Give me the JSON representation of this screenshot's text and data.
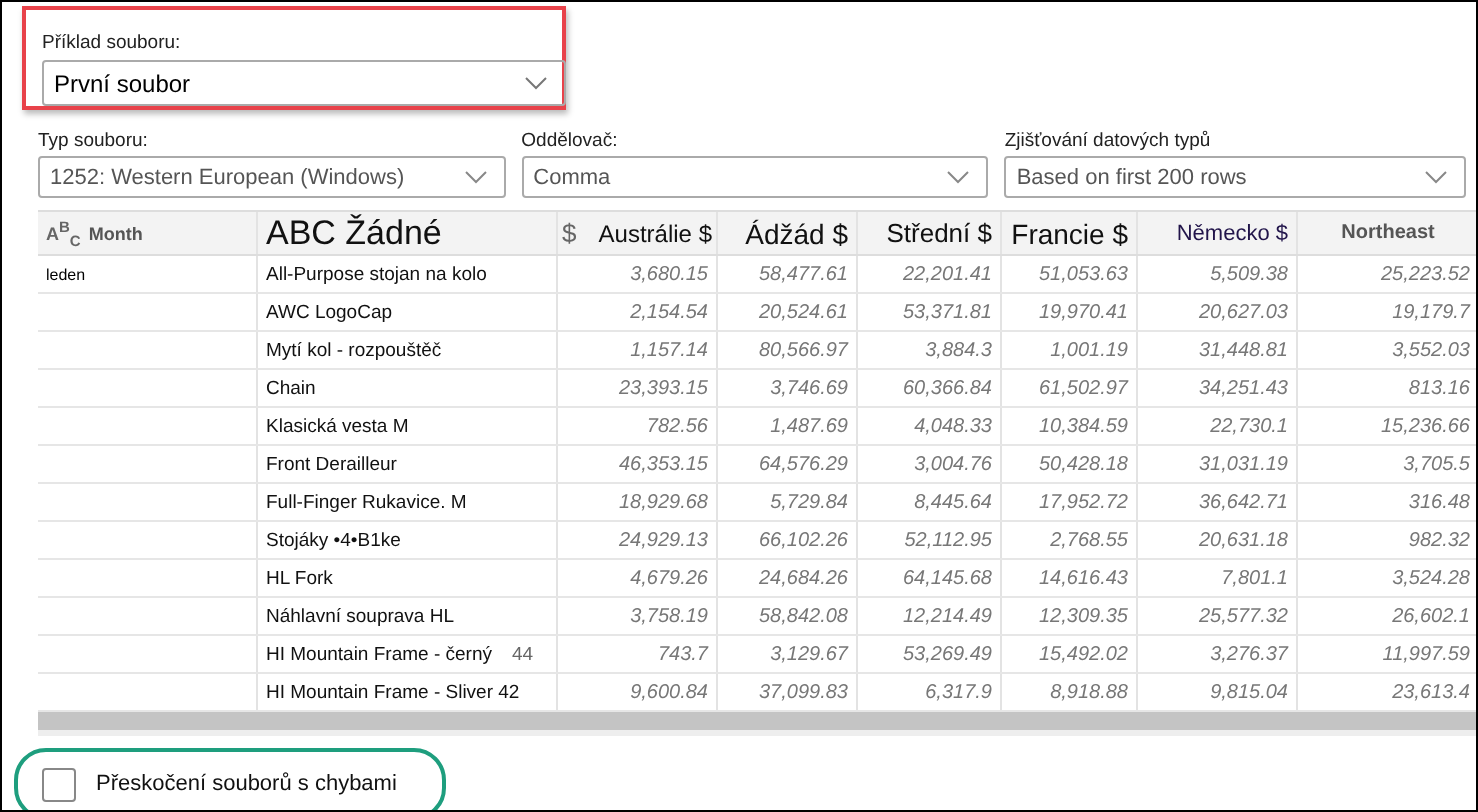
{
  "example": {
    "label": "Příklad souboru:",
    "value": "První soubor",
    "highlight": true
  },
  "options": [
    {
      "label": "Typ souboru:",
      "value": "1252: Western European (Windows)"
    },
    {
      "label": "Oddělovač:",
      "value": "Comma"
    },
    {
      "label": "Zjišťování datových typů",
      "value": "Based on first 200 rows"
    }
  ],
  "table": {
    "columns": [
      {
        "type_icon": "A$^{B}$$_{C}$",
        "label": "Month"
      },
      {
        "label": "ABC Žádné"
      },
      {
        "type_icon": "$",
        "label": "Austrálie $"
      },
      {
        "label": "Ádžád $"
      },
      {
        "label": "Střední $"
      },
      {
        "label": "Francie $"
      },
      {
        "label": "Německo $"
      },
      {
        "label": "Northeast"
      }
    ],
    "rows": [
      {
        "month": "leden",
        "name": "All-Purpose stojan na kolo",
        "values": [
          "3,680.15",
          "58,477.61",
          "22,201.41",
          "51,053.63",
          "5,509.38",
          "25,223.52"
        ]
      },
      {
        "name": "AWC LogoCap",
        "values": [
          "2,154.54",
          "20,524.61",
          "53,371.81",
          "19,970.41",
          "20,627.03",
          "19,179.7"
        ]
      },
      {
        "name": "Mytí kol - rozpouštěč",
        "values": [
          "1,157.14",
          "80,566.97",
          "3,884.3",
          "1,001.19",
          "31,448.81",
          "3,552.03"
        ]
      },
      {
        "name": "Chain",
        "values": [
          "23,393.15",
          "3,746.69",
          "60,366.84",
          "61,502.97",
          "34,251.43",
          "813.16"
        ]
      },
      {
        "name": "Klasická vesta M",
        "values": [
          "782.56",
          "1,487.69",
          "4,048.33",
          "10,384.59",
          "22,730.1",
          "15,236.66"
        ]
      },
      {
        "name": "Front Derailleur",
        "values": [
          "46,353.15",
          "64,576.29",
          "3,004.76",
          "50,428.18",
          "31,031.19",
          "3,705.5"
        ]
      },
      {
        "name": "Full-Finger Rukavice. M",
        "values": [
          "18,929.68",
          "5,729.84",
          "8,445.64",
          "17,952.72",
          "36,642.71",
          "316.48"
        ]
      },
      {
        "name": "Stojáky •4•B1ke",
        "values": [
          "24,929.13",
          "66,102.26",
          "52,112.95",
          "2,768.55",
          "20,631.18",
          "982.32"
        ]
      },
      {
        "name": "HL Fork",
        "values": [
          "4,679.26",
          "24,684.26",
          "64,145.68",
          "14,616.43",
          "7,801.1",
          "3,524.28"
        ]
      },
      {
        "name": "Náhlavní souprava HL",
        "values": [
          "3,758.19",
          "58,842.08",
          "12,214.49",
          "12,309.35",
          "25,577.32",
          "26,602.1"
        ]
      },
      {
        "name": "HI Mountain Frame - černý",
        "note": "44",
        "values": [
          "743.7",
          "3,129.67",
          "53,269.49",
          "15,492.02",
          "3,276.37",
          "11,997.59"
        ]
      },
      {
        "name": "HI Mountain Frame - Sliver 42",
        "values": [
          "9,600.84",
          "37,099.83",
          "6,317.9",
          "8,918.88",
          "9,815.04",
          "23,613.4"
        ]
      }
    ]
  },
  "skip_errors": {
    "label": "Přeskočení souborů s chybami",
    "checked": false,
    "highlight": true
  }
}
